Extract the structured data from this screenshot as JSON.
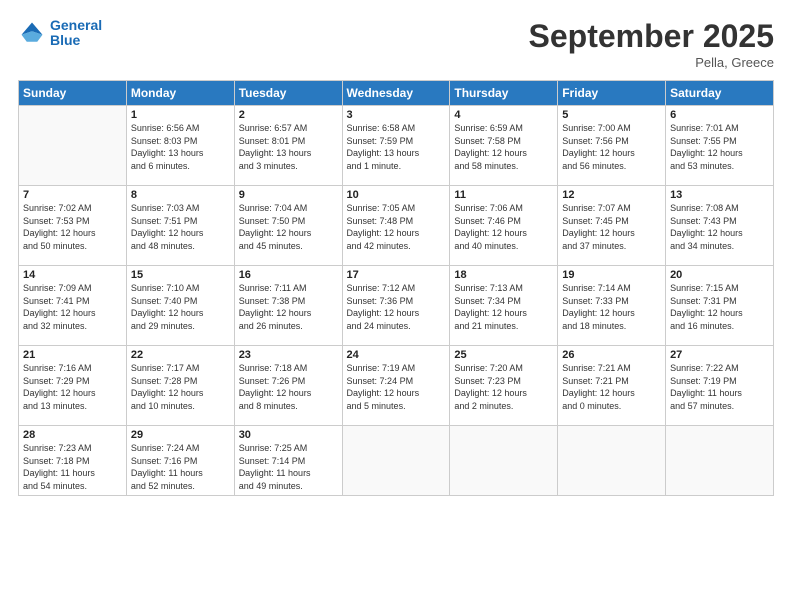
{
  "header": {
    "logo_line1": "General",
    "logo_line2": "Blue",
    "month": "September 2025",
    "location": "Pella, Greece"
  },
  "weekdays": [
    "Sunday",
    "Monday",
    "Tuesday",
    "Wednesday",
    "Thursday",
    "Friday",
    "Saturday"
  ],
  "weeks": [
    [
      {
        "day": "",
        "info": ""
      },
      {
        "day": "1",
        "info": "Sunrise: 6:56 AM\nSunset: 8:03 PM\nDaylight: 13 hours\nand 6 minutes."
      },
      {
        "day": "2",
        "info": "Sunrise: 6:57 AM\nSunset: 8:01 PM\nDaylight: 13 hours\nand 3 minutes."
      },
      {
        "day": "3",
        "info": "Sunrise: 6:58 AM\nSunset: 7:59 PM\nDaylight: 13 hours\nand 1 minute."
      },
      {
        "day": "4",
        "info": "Sunrise: 6:59 AM\nSunset: 7:58 PM\nDaylight: 12 hours\nand 58 minutes."
      },
      {
        "day": "5",
        "info": "Sunrise: 7:00 AM\nSunset: 7:56 PM\nDaylight: 12 hours\nand 56 minutes."
      },
      {
        "day": "6",
        "info": "Sunrise: 7:01 AM\nSunset: 7:55 PM\nDaylight: 12 hours\nand 53 minutes."
      }
    ],
    [
      {
        "day": "7",
        "info": "Sunrise: 7:02 AM\nSunset: 7:53 PM\nDaylight: 12 hours\nand 50 minutes."
      },
      {
        "day": "8",
        "info": "Sunrise: 7:03 AM\nSunset: 7:51 PM\nDaylight: 12 hours\nand 48 minutes."
      },
      {
        "day": "9",
        "info": "Sunrise: 7:04 AM\nSunset: 7:50 PM\nDaylight: 12 hours\nand 45 minutes."
      },
      {
        "day": "10",
        "info": "Sunrise: 7:05 AM\nSunset: 7:48 PM\nDaylight: 12 hours\nand 42 minutes."
      },
      {
        "day": "11",
        "info": "Sunrise: 7:06 AM\nSunset: 7:46 PM\nDaylight: 12 hours\nand 40 minutes."
      },
      {
        "day": "12",
        "info": "Sunrise: 7:07 AM\nSunset: 7:45 PM\nDaylight: 12 hours\nand 37 minutes."
      },
      {
        "day": "13",
        "info": "Sunrise: 7:08 AM\nSunset: 7:43 PM\nDaylight: 12 hours\nand 34 minutes."
      }
    ],
    [
      {
        "day": "14",
        "info": "Sunrise: 7:09 AM\nSunset: 7:41 PM\nDaylight: 12 hours\nand 32 minutes."
      },
      {
        "day": "15",
        "info": "Sunrise: 7:10 AM\nSunset: 7:40 PM\nDaylight: 12 hours\nand 29 minutes."
      },
      {
        "day": "16",
        "info": "Sunrise: 7:11 AM\nSunset: 7:38 PM\nDaylight: 12 hours\nand 26 minutes."
      },
      {
        "day": "17",
        "info": "Sunrise: 7:12 AM\nSunset: 7:36 PM\nDaylight: 12 hours\nand 24 minutes."
      },
      {
        "day": "18",
        "info": "Sunrise: 7:13 AM\nSunset: 7:34 PM\nDaylight: 12 hours\nand 21 minutes."
      },
      {
        "day": "19",
        "info": "Sunrise: 7:14 AM\nSunset: 7:33 PM\nDaylight: 12 hours\nand 18 minutes."
      },
      {
        "day": "20",
        "info": "Sunrise: 7:15 AM\nSunset: 7:31 PM\nDaylight: 12 hours\nand 16 minutes."
      }
    ],
    [
      {
        "day": "21",
        "info": "Sunrise: 7:16 AM\nSunset: 7:29 PM\nDaylight: 12 hours\nand 13 minutes."
      },
      {
        "day": "22",
        "info": "Sunrise: 7:17 AM\nSunset: 7:28 PM\nDaylight: 12 hours\nand 10 minutes."
      },
      {
        "day": "23",
        "info": "Sunrise: 7:18 AM\nSunset: 7:26 PM\nDaylight: 12 hours\nand 8 minutes."
      },
      {
        "day": "24",
        "info": "Sunrise: 7:19 AM\nSunset: 7:24 PM\nDaylight: 12 hours\nand 5 minutes."
      },
      {
        "day": "25",
        "info": "Sunrise: 7:20 AM\nSunset: 7:23 PM\nDaylight: 12 hours\nand 2 minutes."
      },
      {
        "day": "26",
        "info": "Sunrise: 7:21 AM\nSunset: 7:21 PM\nDaylight: 12 hours\nand 0 minutes."
      },
      {
        "day": "27",
        "info": "Sunrise: 7:22 AM\nSunset: 7:19 PM\nDaylight: 11 hours\nand 57 minutes."
      }
    ],
    [
      {
        "day": "28",
        "info": "Sunrise: 7:23 AM\nSunset: 7:18 PM\nDaylight: 11 hours\nand 54 minutes."
      },
      {
        "day": "29",
        "info": "Sunrise: 7:24 AM\nSunset: 7:16 PM\nDaylight: 11 hours\nand 52 minutes."
      },
      {
        "day": "30",
        "info": "Sunrise: 7:25 AM\nSunset: 7:14 PM\nDaylight: 11 hours\nand 49 minutes."
      },
      {
        "day": "",
        "info": ""
      },
      {
        "day": "",
        "info": ""
      },
      {
        "day": "",
        "info": ""
      },
      {
        "day": "",
        "info": ""
      }
    ]
  ]
}
